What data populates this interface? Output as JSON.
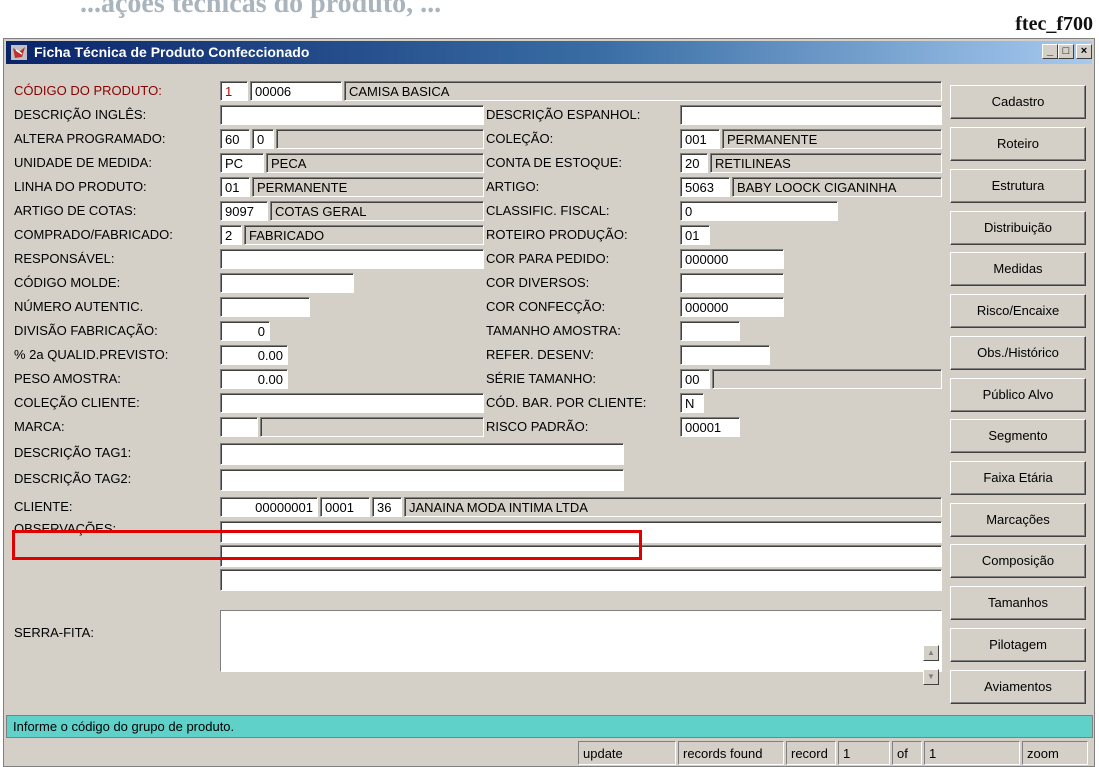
{
  "doc": {
    "cut_title": "...ações técnicas do produto, ...",
    "code": "ftec_f700"
  },
  "window": {
    "title": "Ficha Técnica de Produto Confeccionado",
    "min": "_",
    "max": "□",
    "close": "×"
  },
  "fields": {
    "codigo_produto": {
      "label": "CÓDIGO DO PRODUTO:",
      "v1": "1",
      "v2": "00006",
      "v3": "CAMISA BASICA"
    },
    "descricao_ingles": {
      "label": "DESCRIÇÃO INGLÊS:",
      "value": ""
    },
    "descricao_espanhol": {
      "label": "DESCRIÇÃO ESPANHOL:",
      "value": ""
    },
    "altera_programado": {
      "label": "ALTERA PROGRAMADO:",
      "v1": "60",
      "v2": "0",
      "v3": ""
    },
    "colecao": {
      "label": "COLEÇÃO:",
      "v1": "001",
      "v2": "PERMANENTE"
    },
    "unidade_medida": {
      "label": "UNIDADE DE MEDIDA:",
      "v1": "PC",
      "v2": "PECA"
    },
    "conta_estoque": {
      "label": "CONTA DE ESTOQUE:",
      "v1": "20",
      "v2": "RETILINEAS"
    },
    "linha_produto": {
      "label": "LINHA DO PRODUTO:",
      "v1": "01",
      "v2": "PERMANENTE"
    },
    "artigo": {
      "label": "ARTIGO:",
      "v1": "5063",
      "v2": "BABY LOOCK CIGANINHA"
    },
    "artigo_cotas": {
      "label": "ARTIGO DE COTAS:",
      "v1": "9097",
      "v2": "COTAS GERAL"
    },
    "classific_fiscal": {
      "label": "CLASSIFIC. FISCAL:",
      "value": "0"
    },
    "comprado_fabricado": {
      "label": "COMPRADO/FABRICADO:",
      "v1": "2",
      "v2": "FABRICADO"
    },
    "roteiro_producao": {
      "label": "ROTEIRO PRODUÇÃO:",
      "value": "01"
    },
    "responsavel": {
      "label": "RESPONSÁVEL:",
      "value": ""
    },
    "cor_pedido": {
      "label": "COR PARA PEDIDO:",
      "value": "000000"
    },
    "codigo_molde": {
      "label": "CÓDIGO MOLDE:",
      "value": ""
    },
    "cor_diversos": {
      "label": "COR DIVERSOS:",
      "value": ""
    },
    "numero_autentic": {
      "label": "NÚMERO AUTENTIC.",
      "value": ""
    },
    "cor_confeccao": {
      "label": "COR CONFECÇÃO:",
      "value": "000000"
    },
    "divisao_fabricacao": {
      "label": "DIVISÃO FABRICAÇÃO:",
      "value": "0"
    },
    "tamanho_amostra": {
      "label": "TAMANHO AMOSTRA:",
      "value": ""
    },
    "qualid_previsto": {
      "label": "% 2a QUALID.PREVISTO:",
      "value": "0.00"
    },
    "refer_desenv": {
      "label": "REFER. DESENV:",
      "value": ""
    },
    "peso_amostra": {
      "label": "PESO AMOSTRA:",
      "value": "0.00"
    },
    "serie_tamanho": {
      "label": "SÉRIE TAMANHO:",
      "v1": "00",
      "v2": ""
    },
    "colecao_cliente": {
      "label": "COLEÇÃO CLIENTE:",
      "value": ""
    },
    "cod_bar_cliente": {
      "label": "CÓD. BAR. POR CLIENTE:",
      "value": "N"
    },
    "marca": {
      "label": "MARCA:",
      "v1": "",
      "v2": ""
    },
    "risco_padrao": {
      "label": "RISCO PADRÃO:",
      "value": "00001"
    },
    "descricao_tag1": {
      "label": "DESCRIÇÃO TAG1:",
      "value": ""
    },
    "descricao_tag2": {
      "label": "DESCRIÇÃO TAG2:",
      "value": ""
    },
    "cliente": {
      "label": "CLIENTE:",
      "v1": "00000001",
      "v2": "0001",
      "v3": "36",
      "v4": "JANAINA MODA INTIMA LTDA"
    },
    "observacoes": {
      "label": "OBSERVAÇÕES:",
      "l1": "",
      "l2": "",
      "l3": ""
    },
    "serra_fita": {
      "label": "SERRA-FITA:",
      "value": ""
    }
  },
  "buttons": [
    "Cadastro",
    "Roteiro",
    "Estrutura",
    "Distribuição",
    "Medidas",
    "Risco/Encaixe",
    "Obs./Histórico",
    "Público Alvo",
    "Segmento",
    "Faixa Etária",
    "Marcações",
    "Composição",
    "Tamanhos",
    "Pilotagem",
    "Aviamentos"
  ],
  "status": {
    "message": "Informe o código do grupo de produto.",
    "mode": "update",
    "records_found": "records found",
    "record_label": "record",
    "record_value": "1",
    "of_label": "of",
    "of_value": "1",
    "zoom": "zoom"
  },
  "colors": {
    "title_start": "#0a246a",
    "title_end": "#a6caf0",
    "status_bar": "#5fd1c9",
    "label_red": "#8b0000",
    "highlight": "#e00000"
  }
}
